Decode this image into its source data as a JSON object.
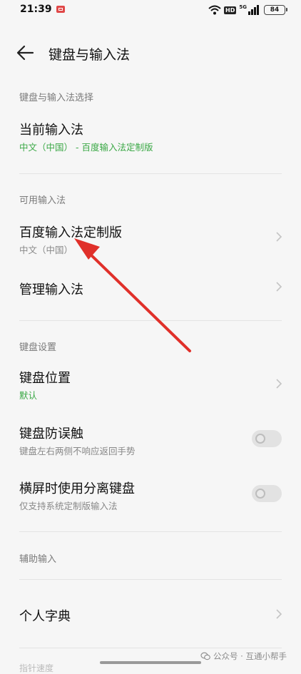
{
  "status": {
    "time": "21:39",
    "hd": "HD",
    "network": "5G",
    "battery": "84"
  },
  "header": {
    "title": "键盘与输入法"
  },
  "sections": {
    "select_label": "键盘与输入法选择",
    "current_ime_title": "当前输入法",
    "current_ime_value": "中文（中国） - 百度输入法定制版",
    "available_label": "可用输入法",
    "baidu_title": "百度输入法定制版",
    "baidu_sub": "中文（中国）",
    "manage_title": "管理输入法",
    "keyboard_settings_label": "键盘设置",
    "position_title": "键盘位置",
    "position_value": "默认",
    "mistouch_title": "键盘防误触",
    "mistouch_sub": "键盘左右两侧不响应返回手势",
    "split_title": "横屏时使用分离键盘",
    "split_sub": "仅支持系统定制版输入法",
    "assist_label": "辅助输入",
    "dictionary_title": "个人字典",
    "bottom_partial": "指针速度"
  },
  "toggles": {
    "mistouch_on": false,
    "split_on": false
  },
  "watermark": {
    "text": "公众号 · 互通小帮手"
  },
  "colors": {
    "accent_green": "#3aa845",
    "annotation_red": "#e0302a"
  },
  "icons": {
    "back": "back-arrow-icon",
    "chevron": "chevron-right-icon",
    "wifi": "wifi-icon",
    "battery": "battery-icon"
  }
}
